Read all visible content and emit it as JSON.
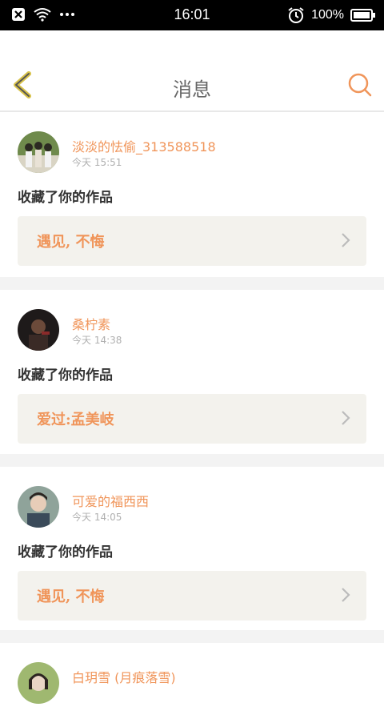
{
  "status_bar": {
    "time": "16:01",
    "battery": "100%",
    "notif_icon": "x-box-icon",
    "wifi_icon": "wifi-icon",
    "more_icon": "dots-icon",
    "alarm_icon": "alarm-icon",
    "battery_icon": "battery-icon"
  },
  "header": {
    "title": "消息",
    "back_icon": "chevron-left-icon",
    "search_icon": "search-icon"
  },
  "colors": {
    "accent": "#f0955a",
    "back": "#d8c24a",
    "card_bg": "#ffffff",
    "work_bg": "#f3f2ed",
    "page_bg": "#f3f3f3"
  },
  "messages": [
    {
      "name": "淡淡的怯偷_313588518",
      "time": "今天 15:51",
      "action": "收藏了你的作品",
      "work": "遇见, 不悔"
    },
    {
      "name": "桑柠素",
      "time": "今天 14:38",
      "action": "收藏了你的作品",
      "work": "爱过:孟美岐"
    },
    {
      "name": "可爱的福西西",
      "time": "今天 14:05",
      "action": "收藏了你的作品",
      "work": "遇见, 不悔"
    },
    {
      "name": "白玥雪 (月痕落雪)",
      "time": "",
      "action": "",
      "work": ""
    }
  ]
}
